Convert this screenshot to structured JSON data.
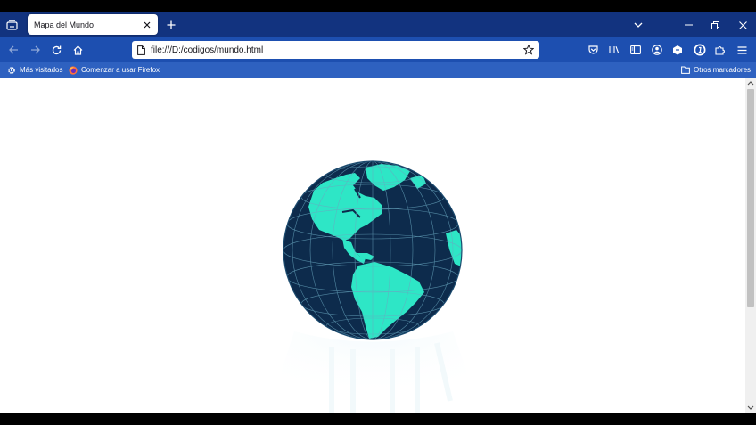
{
  "tabs": [
    {
      "title": "Mapa del Mundo",
      "active": true
    }
  ],
  "url": "file:///D:/codigos/mundo.html",
  "bookmarks": {
    "left": [
      {
        "label": "Más visitados",
        "icon": "gear-icon"
      },
      {
        "label": "Comenzar a usar Firefox",
        "icon": "firefox-icon"
      }
    ],
    "right": {
      "label": "Otros marcadores",
      "icon": "folder-icon"
    }
  },
  "colors": {
    "tabstrip": "#12337f",
    "toolbar": "#1d4fb0",
    "bookmarks_bar": "#2e61c0",
    "globe_ocean": "#0d2b4c",
    "globe_land": "#2ee6c6",
    "graticule": "#6aa8c0"
  }
}
